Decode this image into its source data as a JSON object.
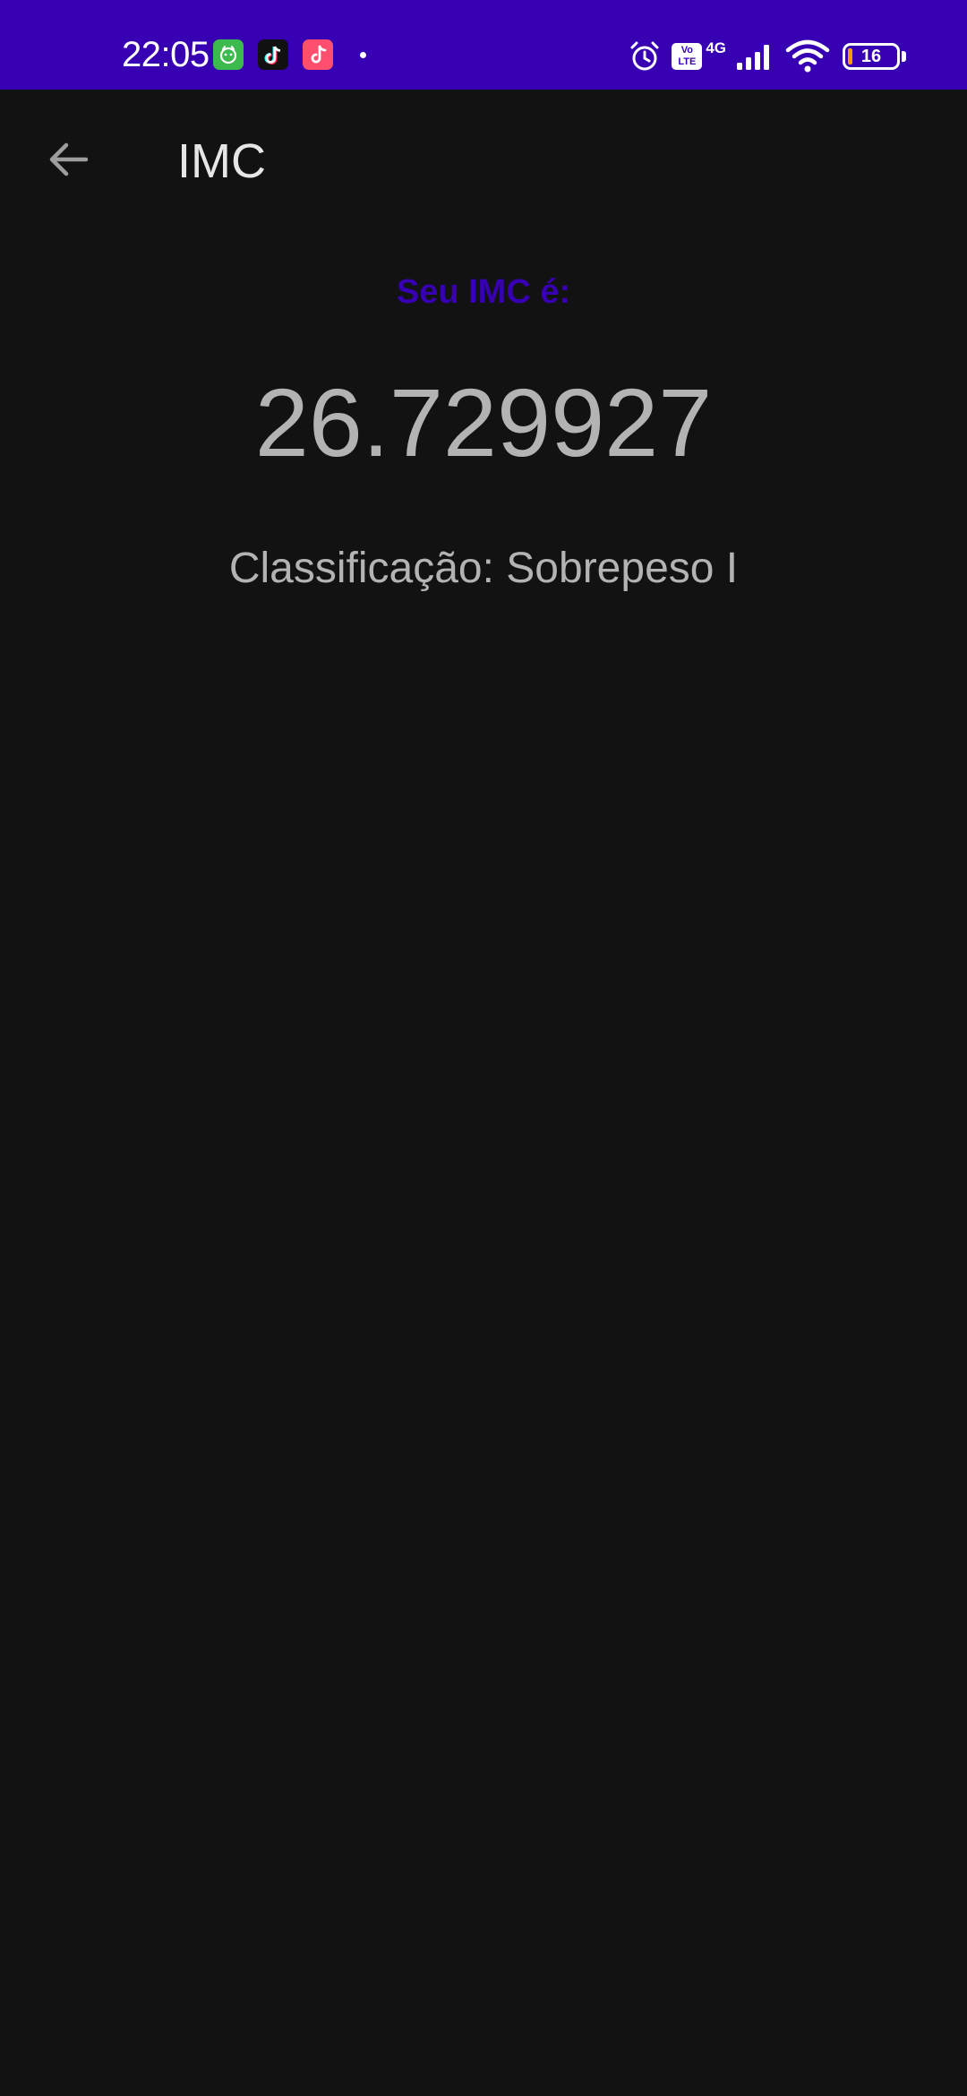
{
  "status_bar": {
    "time": "22:05",
    "network": "4G",
    "volte": [
      "Vo",
      "LTE"
    ],
    "battery_level": "16",
    "colors": {
      "background": "#3700b3"
    },
    "icons": [
      "app-notification-icon",
      "tiktok-icon",
      "music-icon",
      "alarm-icon",
      "volte-icon",
      "signal-icon",
      "wifi-icon",
      "battery-icon"
    ]
  },
  "app_bar": {
    "title": "IMC",
    "back_icon": "arrow-back-icon"
  },
  "result": {
    "label": "Seu IMC é:",
    "value": "26.729927",
    "classification": "Classificação: Sobrepeso I"
  },
  "colors": {
    "accent": "#3700b3",
    "background": "#121212",
    "text_primary": "#e6e6e6",
    "text_secondary": "#b3b3b3"
  }
}
